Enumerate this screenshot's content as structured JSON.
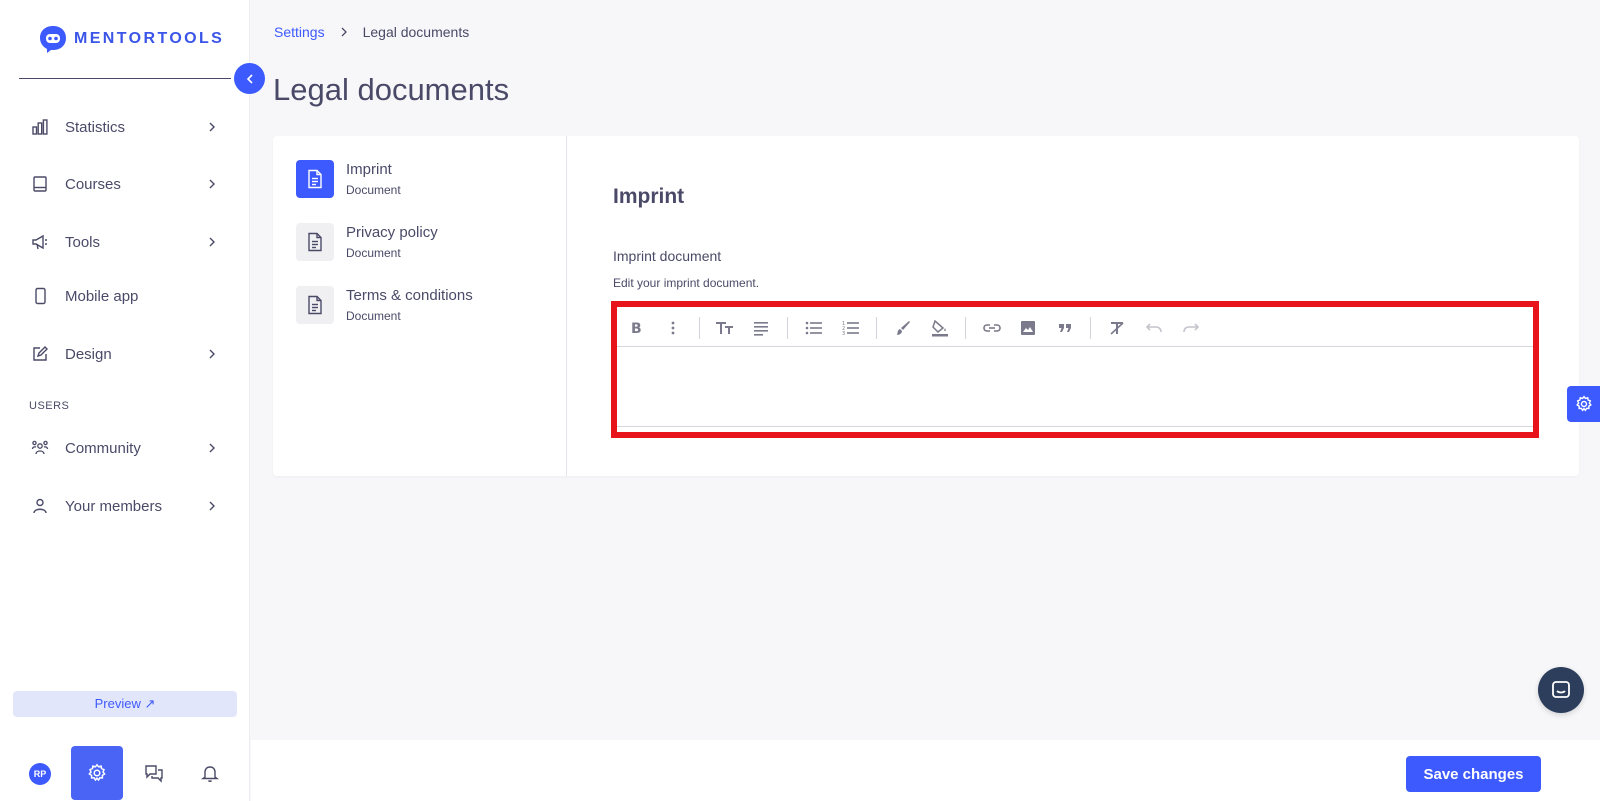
{
  "brand": {
    "name": "MENTORTOOLS"
  },
  "sidebar": {
    "items": [
      {
        "label": "Statistics",
        "icon": "bar-chart-icon",
        "has_chevron": true
      },
      {
        "label": "Courses",
        "icon": "book-icon",
        "has_chevron": true
      },
      {
        "label": "Tools",
        "icon": "megaphone-icon",
        "has_chevron": true
      },
      {
        "label": "Mobile app",
        "icon": "phone-icon",
        "has_chevron": false
      },
      {
        "label": "Design",
        "icon": "pencil-icon",
        "has_chevron": true
      },
      {
        "label": "Community",
        "icon": "community-icon",
        "has_chevron": true
      },
      {
        "label": "Your members",
        "icon": "user-icon",
        "has_chevron": true
      }
    ],
    "section_users": "USERS",
    "preview_label": "Preview ↗",
    "avatar_initials": "RP"
  },
  "breadcrumb": {
    "parent": "Settings",
    "current": "Legal documents"
  },
  "page": {
    "title": "Legal documents"
  },
  "documents": [
    {
      "title": "Imprint",
      "subtitle": "Document",
      "active": true
    },
    {
      "title": "Privacy policy",
      "subtitle": "Document",
      "active": false
    },
    {
      "title": "Terms & conditions",
      "subtitle": "Document",
      "active": false
    }
  ],
  "editor_section": {
    "title": "Imprint",
    "label": "Imprint document",
    "help": "Edit your imprint document.",
    "toolbar": [
      "bold-icon",
      "more-vertical-icon",
      "text-size-icon",
      "align-icon",
      "bullet-list-icon",
      "numbered-list-icon",
      "brush-icon",
      "fill-color-icon",
      "link-icon",
      "image-icon",
      "quote-icon",
      "clear-format-icon",
      "undo-icon",
      "redo-icon"
    ],
    "content": ""
  },
  "footer": {
    "save_label": "Save changes"
  },
  "colors": {
    "accent": "#3d5afe",
    "highlight": "#e8141b",
    "text": "#4a4a68"
  }
}
